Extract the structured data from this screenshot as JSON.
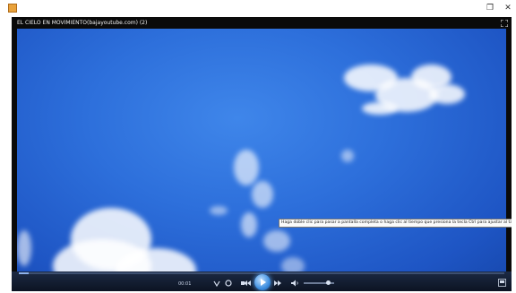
{
  "window": {
    "icon": "media-player-icon",
    "restore_icon": "restore-icon",
    "close_icon": "close-icon",
    "close_glyph": "✕",
    "restore_glyph": "❐"
  },
  "video": {
    "title": "EL CIELO EN MOVIMIENTO(bajayoutube.com) (2)",
    "tooltip": "Haga doble clic para pasar a pantalla completa o haga clic al tiempo que presiona la tecla Ctrl para ajustar al tamaño del video"
  },
  "controls": {
    "time": "00:01",
    "progress": 0.02,
    "volume": 0.8,
    "shuffle_icon": "shuffle-icon",
    "repeat_icon": "repeat-icon",
    "stop_icon": "stop-icon",
    "previous_icon": "previous-icon",
    "play_icon": "play-icon",
    "next_icon": "next-icon",
    "volume_icon": "volume-icon",
    "switch_view_icon": "switch-to-library-icon"
  },
  "colors": {
    "sky": "#2d6fdb",
    "controls_bg": "#0c1322",
    "accent": "#3e8fe0"
  }
}
